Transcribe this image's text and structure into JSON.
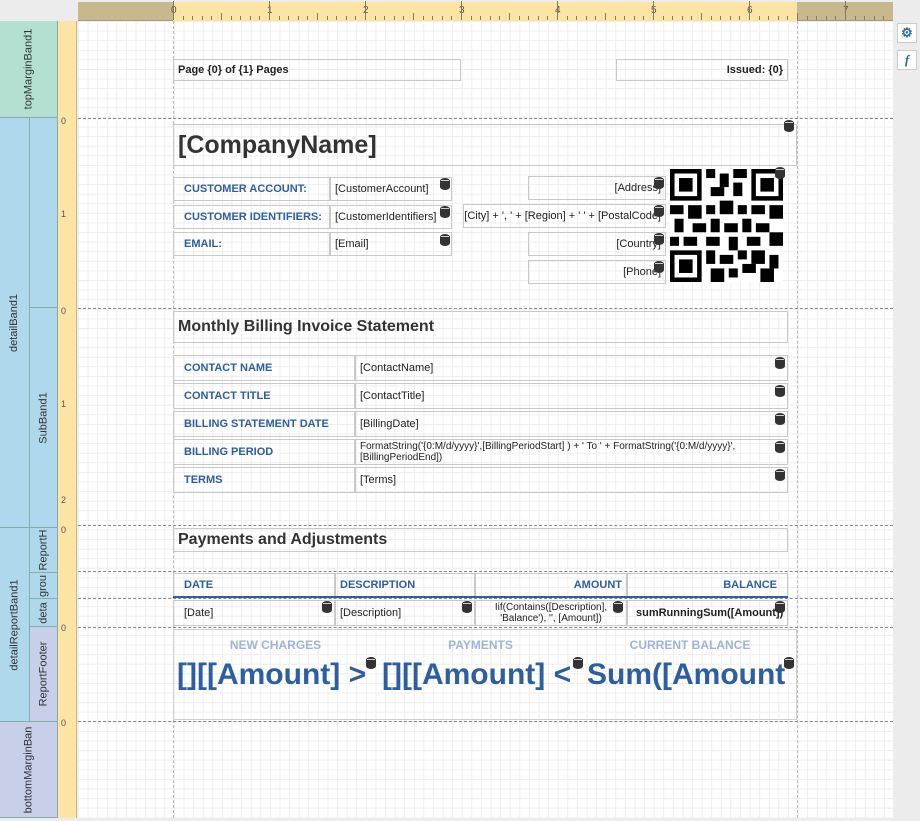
{
  "ruler": {
    "numbers": [
      "0",
      "1",
      "2",
      "3",
      "4",
      "5",
      "6",
      "7"
    ]
  },
  "ruler_left": {
    "numbers": [
      "0",
      "0",
      "1",
      "0",
      "1",
      "2",
      "0",
      "0",
      "1",
      "0"
    ]
  },
  "bands": {
    "topMargin": "topMarginBand1",
    "detail": "detailBand1",
    "subBand": "SubBand1",
    "detailReport": "detailReportBand1",
    "reportHeader": "ReportH",
    "groupHeader": "grou",
    "detail2": "deta",
    "reportFooter": "ReportFooter",
    "bottomMargin": "bottomMarginBan"
  },
  "top_margin": {
    "page_info": "Page {0} of {1} Pages",
    "issued": "Issued: {0}"
  },
  "header": {
    "company": "[CompanyName]",
    "customer_account_label": "CUSTOMER ACCOUNT:",
    "customer_account_value": "[CustomerAccount]",
    "customer_identifiers_label": "CUSTOMER IDENTIFIERS:",
    "customer_identifiers_value": "[CustomerIdentifiers]",
    "email_label": "EMAIL:",
    "email_value": "[Email]",
    "address": "[Address]",
    "city_expr": "[City] + ', ' + [Region] + ' ' + [PostalCode]",
    "country": "[Country]",
    "phone": "[Phone]"
  },
  "statement": {
    "title": "Monthly Billing Invoice Statement",
    "rows": [
      {
        "label": "CONTACT NAME",
        "value": "[ContactName]"
      },
      {
        "label": "CONTACT TITLE",
        "value": "[ContactTitle]"
      },
      {
        "label": "BILLING STATEMENT DATE",
        "value": "[BillingDate]"
      },
      {
        "label": "BILLING PERIOD",
        "value": "FormatString('{0:M/d/yyyy}',[BillingPeriodStart] ) + ' To ' + FormatString('{0:M/d/yyyy}', [BillingPeriodEnd])"
      },
      {
        "label": "TERMS",
        "value": "[Terms]"
      }
    ]
  },
  "payments": {
    "title": "Payments and Adjustments",
    "headers": {
      "date": "DATE",
      "description": "DESCRIPTION",
      "amount": "AMOUNT",
      "balance": "BALANCE"
    },
    "cells": {
      "date": "[Date]",
      "description": "[Description]",
      "amount": "Iif(Contains([Description], 'Balance'), '', [Amount])",
      "balance": "sumRunningSum([Amount])"
    }
  },
  "footer": {
    "new_charges_label": "NEW CHARGES",
    "payments_label": "PAYMENTS",
    "current_balance_label": "CURRENT BALANCE",
    "new_charges_value": "[][[Amount] >",
    "payments_value": "[][[Amount] <",
    "current_balance_value": "Sum([Amount"
  },
  "side_buttons": {
    "properties": "⚙",
    "expression": "f"
  }
}
